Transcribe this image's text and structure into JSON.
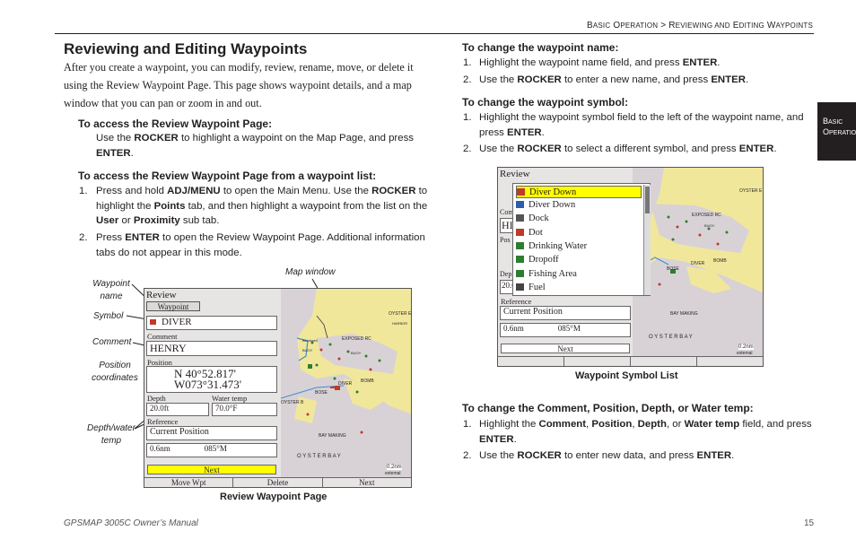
{
  "header": {
    "breadcrumb_a_first": "B",
    "breadcrumb_a_rest": "asic",
    "breadcrumb_b_first": "O",
    "breadcrumb_b_rest": "peration",
    "breadcrumb_sep": ">",
    "breadcrumb_c_first": "R",
    "breadcrumb_c_rest": "eviewing and",
    "breadcrumb_d_first": "E",
    "breadcrumb_d_rest": "diting",
    "breadcrumb_e_first": "W",
    "breadcrumb_e_rest": "aypoints"
  },
  "side_tab": {
    "line1_first": "B",
    "line1_rest": "asic",
    "line2_first": "O",
    "line2_rest": "peration"
  },
  "title": "Reviewing and Editing Waypoints",
  "intro": "After you create a waypoint, you can modify, review, rename, move, or delete it using the Review Waypoint Page. This page shows waypoint details, and a map window that you can pan or zoom in and out.",
  "access": {
    "heading": "To access the Review Waypoint Page:",
    "t1": "Use the ",
    "b1": "ROCKER",
    "t2": " to highlight a waypoint on the Map Page, and press ",
    "b2": "ENTER",
    "t3": "."
  },
  "list_access": {
    "heading": "To access the Review Waypoint Page from a waypoint list:",
    "s1_num": "1.",
    "s1": [
      "Press and hold ",
      "ADJ/MENU",
      " to open the Main Menu. Use the ",
      "ROCKER",
      " to highlight the ",
      "Points",
      " tab, and then highlight a waypoint from the list on the ",
      "User",
      " or ",
      "Proximity",
      " sub tab."
    ],
    "s2_num": "2.",
    "s2": [
      "Press ",
      "ENTER",
      " to open the Review Waypoint Page. Additional information tabs do not appear in this mode."
    ]
  },
  "callouts": {
    "map_window": "Map window",
    "waypoint_name": "Waypoint name",
    "symbol": "Symbol",
    "comment": "Comment",
    "position_coordinates": "Position coordinates",
    "depth_water_temp": "Depth/water temp"
  },
  "review_screen": {
    "title": "Review",
    "tab": "Waypoint",
    "name": "DIVER",
    "comment_label": "Comment",
    "comment": "HENRY",
    "position_label": "Position",
    "lat": "N  40°52.817'",
    "lon": "W073°31.473'",
    "depth_label": "Depth",
    "water_label": "Water temp",
    "depth": "20.0ft",
    "water": "70.0°F",
    "reference_label": "Reference",
    "reference": "Current Position",
    "dist": "0.6nm",
    "bearing": "085°M",
    "next": "Next",
    "softkeys": [
      "Move Wpt",
      "Delete",
      "Next"
    ],
    "map_labels": [
      "OYSTER E",
      "HARBOR",
      "EXPOSED RC",
      "BUOY",
      "DIVER",
      "BOSE",
      "BOMB",
      "OYSTER B",
      "BAY MAKING",
      "O Y S T E R B A Y",
      "0.2nm",
      "extemal",
      "Blockwell",
      "BUOY"
    ]
  },
  "review_caption": "Review Waypoint Page",
  "name_change": {
    "heading": "To change the waypoint name:",
    "s1_num": "1.",
    "s1": [
      "Highlight the waypoint name field, and press ",
      "ENTER",
      "."
    ],
    "s2_num": "2.",
    "s2": [
      "Use the ",
      "ROCKER",
      " to enter a new name, and press ",
      "ENTER",
      "."
    ]
  },
  "symbol_change": {
    "heading": "To change the waypoint symbol:",
    "s1_num": "1.",
    "s1": [
      "Highlight the waypoint symbol field to the left of the waypoint name, and press ",
      "ENTER",
      "."
    ],
    "s2_num": "2.",
    "s2": [
      "Use the ",
      "ROCKER",
      " to select a different symbol, and press ",
      "ENTER",
      "."
    ]
  },
  "symbol_screen": {
    "title": "Review",
    "items": [
      "Diver Down",
      "Diver Down",
      "Dock",
      "Dot",
      "Drinking Water",
      "Dropoff",
      "Fishing Area",
      "Fuel"
    ],
    "item_colors": [
      "#c0392b",
      "#2c5fa8",
      "#555555",
      "#c0392b",
      "#2e7d32",
      "#2e7d32",
      "#2e7d32",
      "#444444"
    ],
    "peek_labels": [
      "Com",
      "HI",
      "Pos",
      "Dep",
      "20.0"
    ],
    "reference_label": "Reference",
    "reference": "Current Position",
    "dist": "0.6nm",
    "bearing": "085°M",
    "next": "Next",
    "map_labels": [
      "OYSTER E",
      "EXPOSED RC",
      "DIVER",
      "BOMB",
      "BOSE",
      "BAY MAKING",
      "O Y S T E R B A Y",
      "0.2nm",
      "extemal",
      "BUOY"
    ]
  },
  "symbol_caption": "Waypoint Symbol List",
  "other_change": {
    "heading": "To change the Comment, Position, Depth, or Water temp:",
    "s1_num": "1.",
    "s1": [
      "Highlight the ",
      "Comment",
      ", ",
      "Position",
      ", ",
      "Depth",
      ", or ",
      "Water temp",
      " field, and press ",
      "ENTER",
      "."
    ],
    "s2_num": "2.",
    "s2": [
      "Use the ",
      "ROCKER",
      " to enter new data, and press ",
      "ENTER",
      "."
    ]
  },
  "footer": {
    "manual": "GPSMAP 3005C Owner’s Manual",
    "page": "15"
  }
}
